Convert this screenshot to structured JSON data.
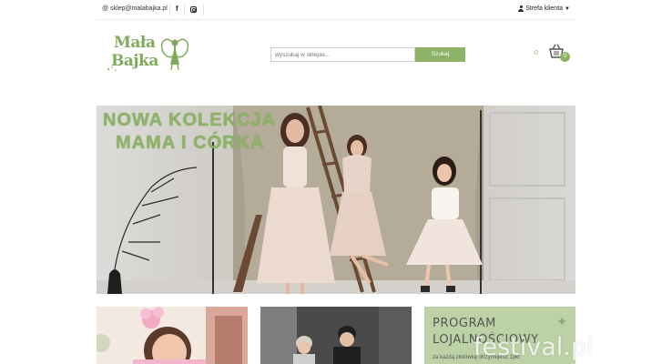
{
  "topbar": {
    "email": "sklep@malabajka.pl",
    "facebook_icon": "facebook-icon",
    "instagram_icon": "instagram-icon",
    "client_area": "Strefa klienta"
  },
  "header": {
    "logo_line1": "Mała",
    "logo_line2": "Bajka",
    "search_placeholder": "wyszukaj w sklepie...",
    "search_button": "Szukaj",
    "cart_total": "0",
    "cart_count": "0"
  },
  "hero": {
    "line1": "NOWA KOLEKCJA",
    "line2": "MAMA I CÓRKA"
  },
  "tiles": {
    "loyalty_line1": "PROGRAM",
    "loyalty_line2": "LOJALNOŚCIOWY",
    "loyalty_sub": "za każdą złotówkę otrzymujesz 1pkt"
  },
  "watermark": "festival.pl",
  "colors": {
    "accent": "#8cb366",
    "loyalty_bg": "#bcd2a6"
  }
}
